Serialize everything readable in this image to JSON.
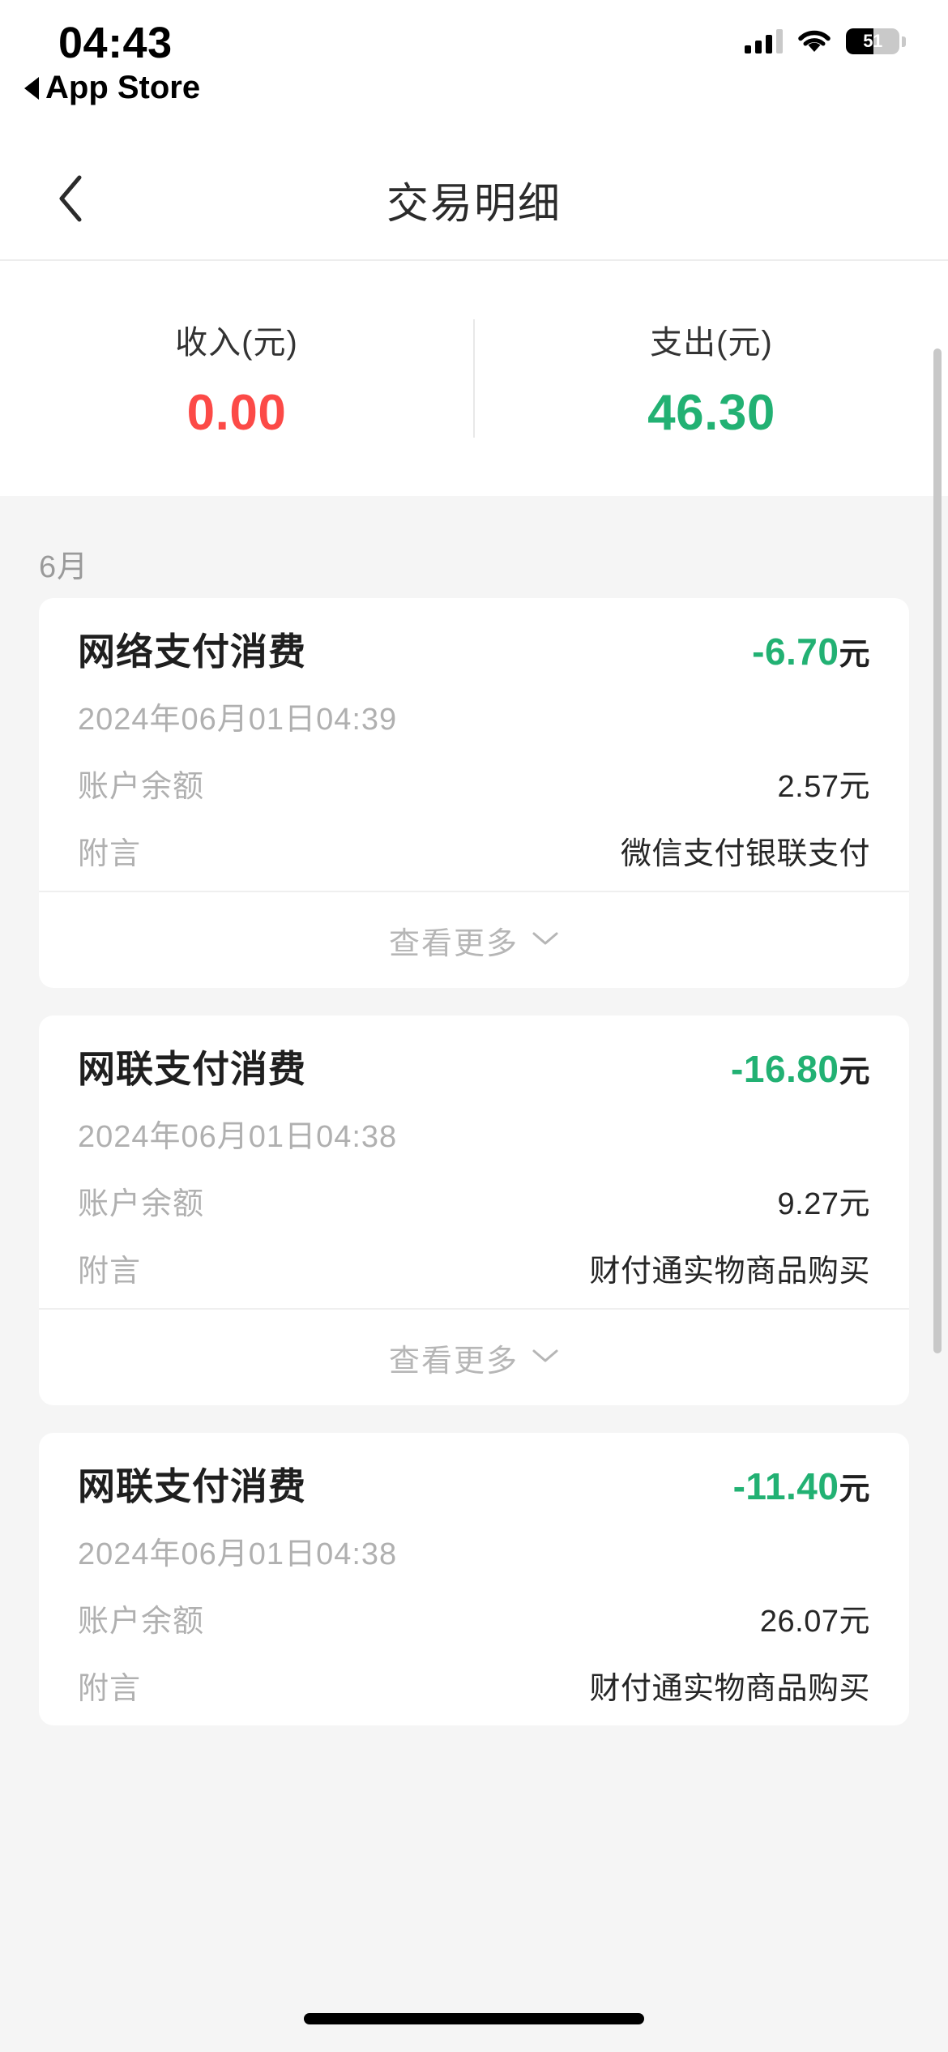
{
  "status_bar": {
    "time": "04:43",
    "back_app_label": "App Store",
    "battery_level": "51",
    "icons": {
      "signal": "signal-bars-icon",
      "wifi": "wifi-icon",
      "battery": "battery-icon"
    }
  },
  "navbar": {
    "title": "交易明细",
    "back_icon": "chevron-left-icon"
  },
  "summary": {
    "income": {
      "label": "收入(元)",
      "value": "0.00",
      "color": "#fc4a47"
    },
    "expense": {
      "label": "支出(元)",
      "value": "46.30",
      "color": "#22b173"
    }
  },
  "list": {
    "month_header": "6月",
    "labels": {
      "balance": "账户余额",
      "note": "附言",
      "view_more": "查看更多"
    },
    "transactions": [
      {
        "title": "网络支付消费",
        "amount": "-6.70",
        "unit": "元",
        "datetime": "2024年06月01日04:39",
        "balance": "2.57元",
        "note": "微信支付银联支付",
        "has_view_more": true
      },
      {
        "title": "网联支付消费",
        "amount": "-16.80",
        "unit": "元",
        "datetime": "2024年06月01日04:38",
        "balance": "9.27元",
        "note": "财付通实物商品购买",
        "has_view_more": true
      },
      {
        "title": "网联支付消费",
        "amount": "-11.40",
        "unit": "元",
        "datetime": "2024年06月01日04:38",
        "balance": "26.07元",
        "note": "财付通实物商品购买",
        "has_view_more": false
      }
    ]
  }
}
